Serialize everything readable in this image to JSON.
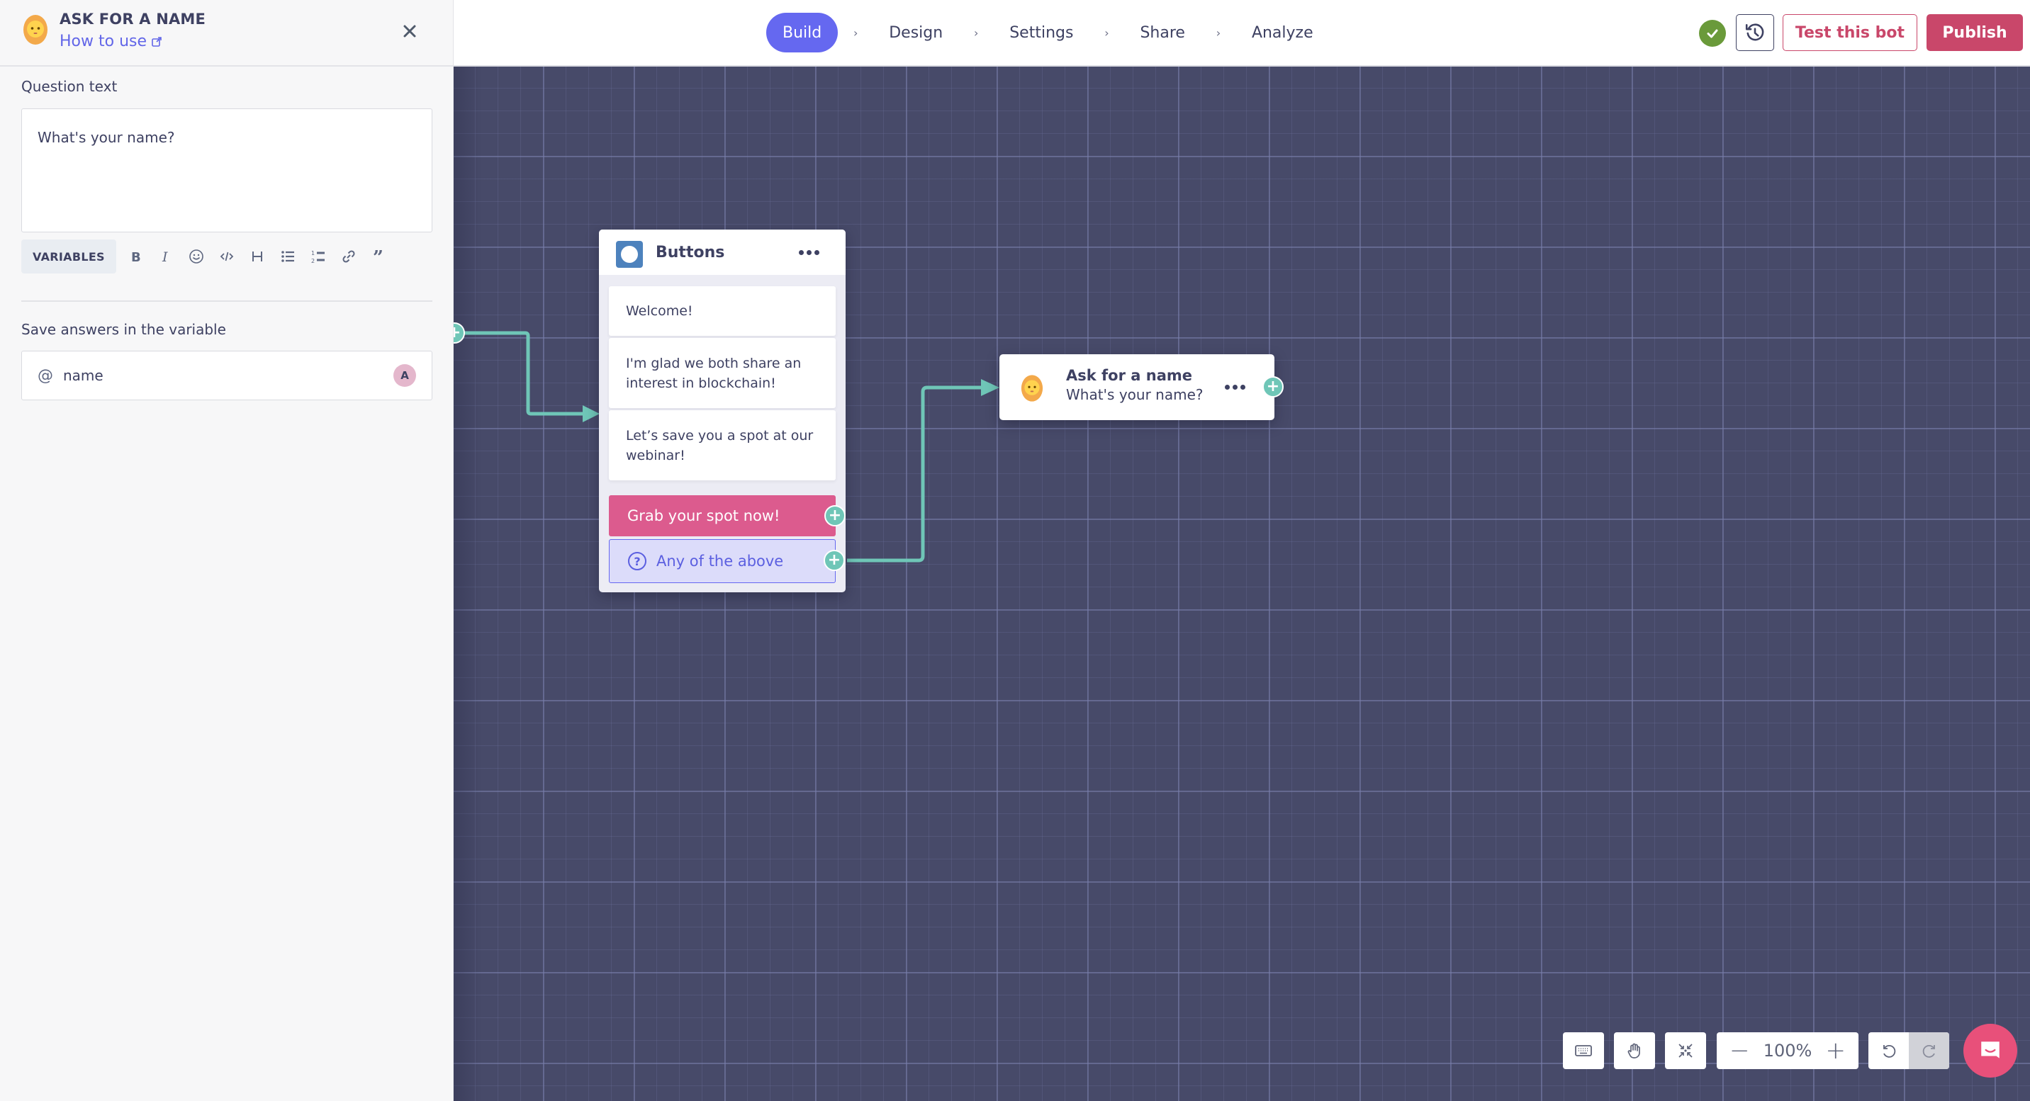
{
  "sidebar": {
    "title": "ASK FOR A NAME",
    "how_to_use": "How to use",
    "avatar_icon": "bearded-person-emoji",
    "question_label": "Question text",
    "question_value": "What's your name?",
    "toolbar": {
      "variables_label": "VARIABLES",
      "buttons": [
        "bold",
        "italic",
        "emoji",
        "code",
        "heading",
        "bullet-list",
        "numbered-list",
        "link",
        "quote"
      ]
    },
    "variable_label": "Save answers in the variable",
    "variable_prefix": "@",
    "variable_value": "name",
    "variable_badge": "A"
  },
  "topbar": {
    "steps": [
      {
        "label": "Build",
        "active": true
      },
      {
        "label": "Design",
        "active": false
      },
      {
        "label": "Settings",
        "active": false
      },
      {
        "label": "Share",
        "active": false
      },
      {
        "label": "Analyze",
        "active": false
      }
    ],
    "step_separator": "›",
    "test_label": "Test this bot",
    "publish_label": "Publish"
  },
  "canvas": {
    "buttons_node": {
      "title": "Buttons",
      "messages": [
        "Welcome!",
        "I'm glad we both share an interest in blockchain!",
        "Let’s save you a spot at our webinar!"
      ],
      "choices": [
        {
          "label": "Grab your spot now!",
          "type": "button"
        },
        {
          "label": "Any of the above",
          "type": "fallback"
        }
      ]
    },
    "ask_node": {
      "title": "Ask for a name",
      "subtitle": "What's your name?"
    },
    "controls": {
      "zoom_level": "100%",
      "zoom_out": "−",
      "zoom_in": "+"
    }
  },
  "colors": {
    "accent": "#6568f0",
    "brand": "#c9476a",
    "canvas_bg": "#474a69",
    "connector": "#6fc6b7",
    "choice_button": "#dc5b8e",
    "status_ok": "#6a9a3a"
  }
}
